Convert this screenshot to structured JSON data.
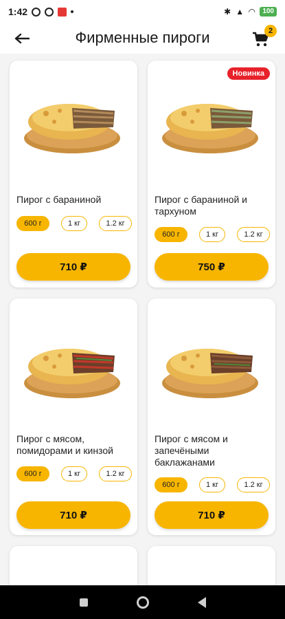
{
  "status": {
    "time": "1:42",
    "battery": "100"
  },
  "header": {
    "title": "Фирменные пироги",
    "cart_count": "2"
  },
  "products": [
    {
      "name": "Пирог с бараниной",
      "sizes": [
        "600 г",
        "1 кг",
        "1.2 кг"
      ],
      "price": "710 ₽",
      "badge": ""
    },
    {
      "name": "Пирог с бараниной и тархуном",
      "sizes": [
        "600 г",
        "1 кг",
        "1.2 кг"
      ],
      "price": "750 ₽",
      "badge": "Новинка"
    },
    {
      "name": "Пирог с мясом, помидорами и кинзой",
      "sizes": [
        "600 г",
        "1 кг",
        "1.2 кг"
      ],
      "price": "710 ₽",
      "badge": ""
    },
    {
      "name": "Пирог с мясом и запечёными баклажанами",
      "sizes": [
        "600 г",
        "1 кг",
        "1.2 кг"
      ],
      "price": "710 ₽",
      "badge": ""
    }
  ],
  "icons": {
    "back": "arrow-left-icon",
    "cart": "cart-icon"
  },
  "colors": {
    "accent": "#f7b500",
    "badge": "#e8222b"
  }
}
